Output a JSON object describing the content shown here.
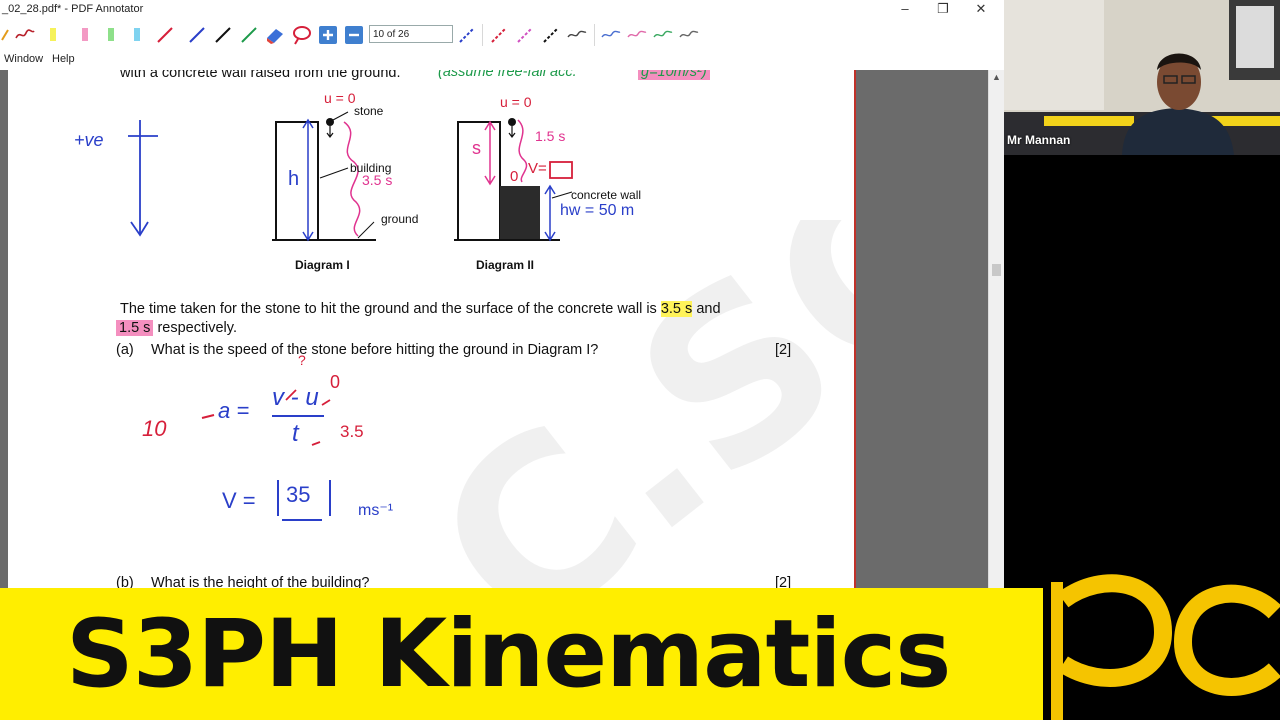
{
  "window": {
    "title": "_02_28.pdf* - PDF Annotator",
    "minimize": "–",
    "restore": "❐",
    "close": "✕"
  },
  "toolbar": {
    "page_field": "10 of 26"
  },
  "menu": {
    "items": [
      "Window",
      "Help"
    ]
  },
  "document": {
    "top_text": "with a concrete wall raised from the ground.",
    "top_note": "(assume free-fall acc.",
    "top_note_highlight": "g=10m/s²)",
    "diagram1": {
      "u_label": "u = 0",
      "stone": "stone",
      "building": "building",
      "time": "3.5 s",
      "ground": "ground",
      "h": "h",
      "caption": "Diagram I"
    },
    "diagram2": {
      "u_label": "u = 0",
      "time": "1.5 s",
      "s": "s",
      "v_label": "V=",
      "zero": "0",
      "concrete_wall": "concrete wall",
      "hw": "hw = 50 m",
      "caption": "Diagram II"
    },
    "sign_convention": "+ve",
    "para_1a": "The time taken for the stone to hit the ground and the surface of the concrete wall is",
    "para_1b": "3.5 s",
    "para_1c": "and",
    "para_2a": "1.5 s",
    "para_2b": "respectively.",
    "q_a_label": "(a)",
    "q_a_text": "What is the speed of the stone before hitting the ground in Diagram I?",
    "q_a_marks": "[2]",
    "work": {
      "ten": "10",
      "a_eq": "a =",
      "frac_top": "v - u",
      "u_zero": "0",
      "frac_bottom": "t",
      "t_value": "3.5",
      "question": "?",
      "v_eq": "V =",
      "answer": "35",
      "unit": "ms⁻¹"
    },
    "q_b_label": "(b)",
    "q_b_text": "What is the height of the building?",
    "q_b_marks": "[2]",
    "watermark": "C.SG"
  },
  "webcam": {
    "name": "Mr Mannan"
  },
  "banner": {
    "title": "S3PH Kinematics"
  },
  "colors": {
    "banner": "#ffee00",
    "ink_blue": "#2a3fc9",
    "ink_red": "#d61f3a",
    "ink_pink": "#e0338f",
    "ink_green": "#1d9a4a",
    "highlight_yellow": "#fff35a",
    "highlight_pink": "#f48fbf"
  }
}
